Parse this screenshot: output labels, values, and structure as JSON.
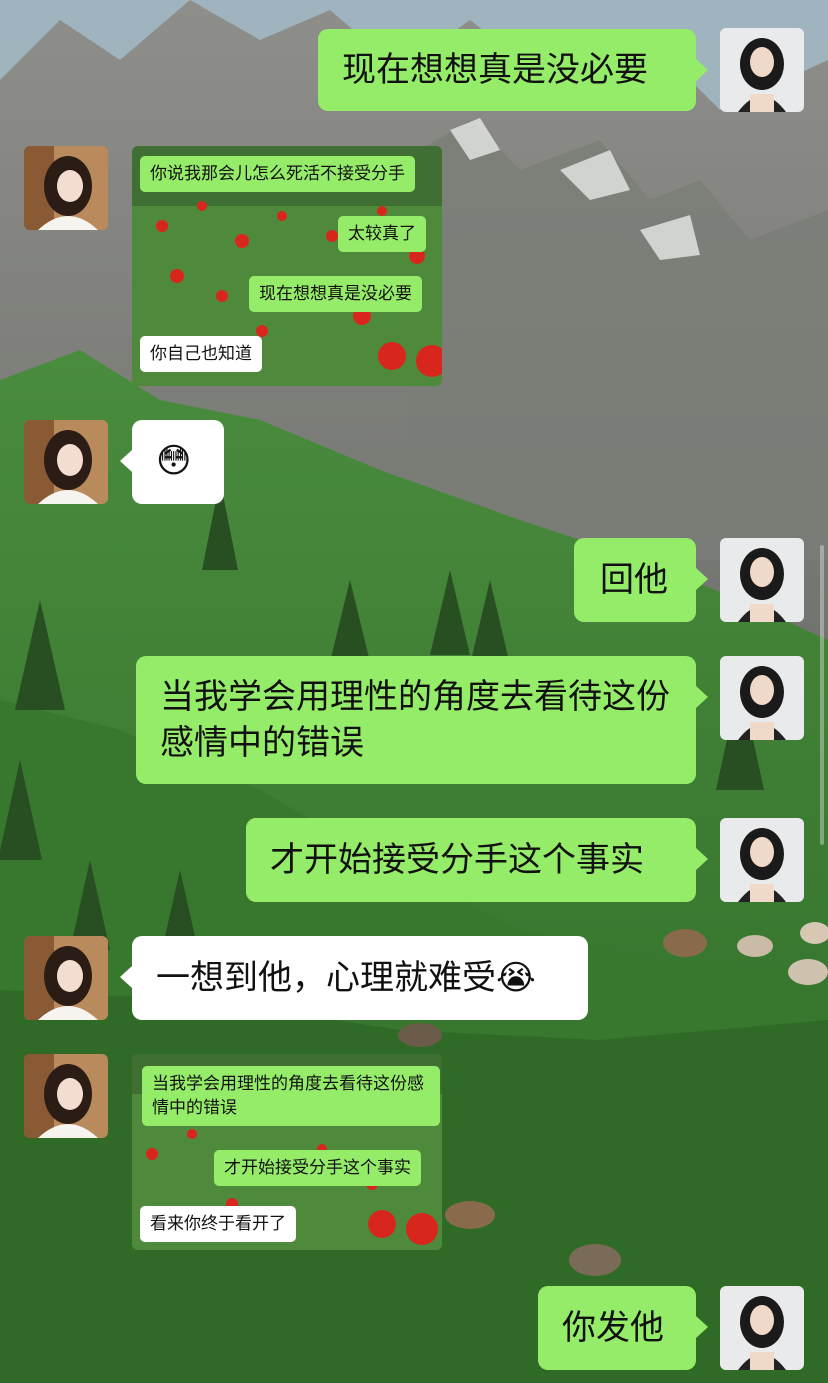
{
  "messages": [
    {
      "side": "me",
      "text": "现在想想真是没必要"
    },
    {
      "side": "them",
      "type": "image",
      "lines": [
        {
          "side": "me",
          "text": "你说我那会儿怎么死活不接受分手"
        },
        {
          "side": "me",
          "text": "太较真了"
        },
        {
          "side": "me",
          "text": "现在想想真是没必要"
        },
        {
          "side": "them",
          "text": "你自己也知道"
        }
      ]
    },
    {
      "side": "them",
      "type": "emoji",
      "emoji": "😳"
    },
    {
      "side": "me",
      "text": "回他"
    },
    {
      "side": "me",
      "text": "当我学会用理性的角度去看待这份感情中的错误"
    },
    {
      "side": "me",
      "text": "才开始接受分手这个事实"
    },
    {
      "side": "them",
      "text": "一想到他，心理就难受😭"
    },
    {
      "side": "them",
      "type": "image",
      "lines": [
        {
          "side": "me",
          "text": "当我学会用理性的角度去看待这份感情中的错误"
        },
        {
          "side": "me",
          "text": "才开始接受分手这个事实"
        },
        {
          "side": "them",
          "text": "看来你终于看开了"
        }
      ]
    },
    {
      "side": "me",
      "text": "你发他"
    }
  ],
  "colors": {
    "me_bubble": "#95ec69",
    "them_bubble": "#ffffff"
  },
  "icons": {
    "my_avatar": "woman-avatar-icon",
    "their_avatar": "woman-avatar-icon"
  }
}
